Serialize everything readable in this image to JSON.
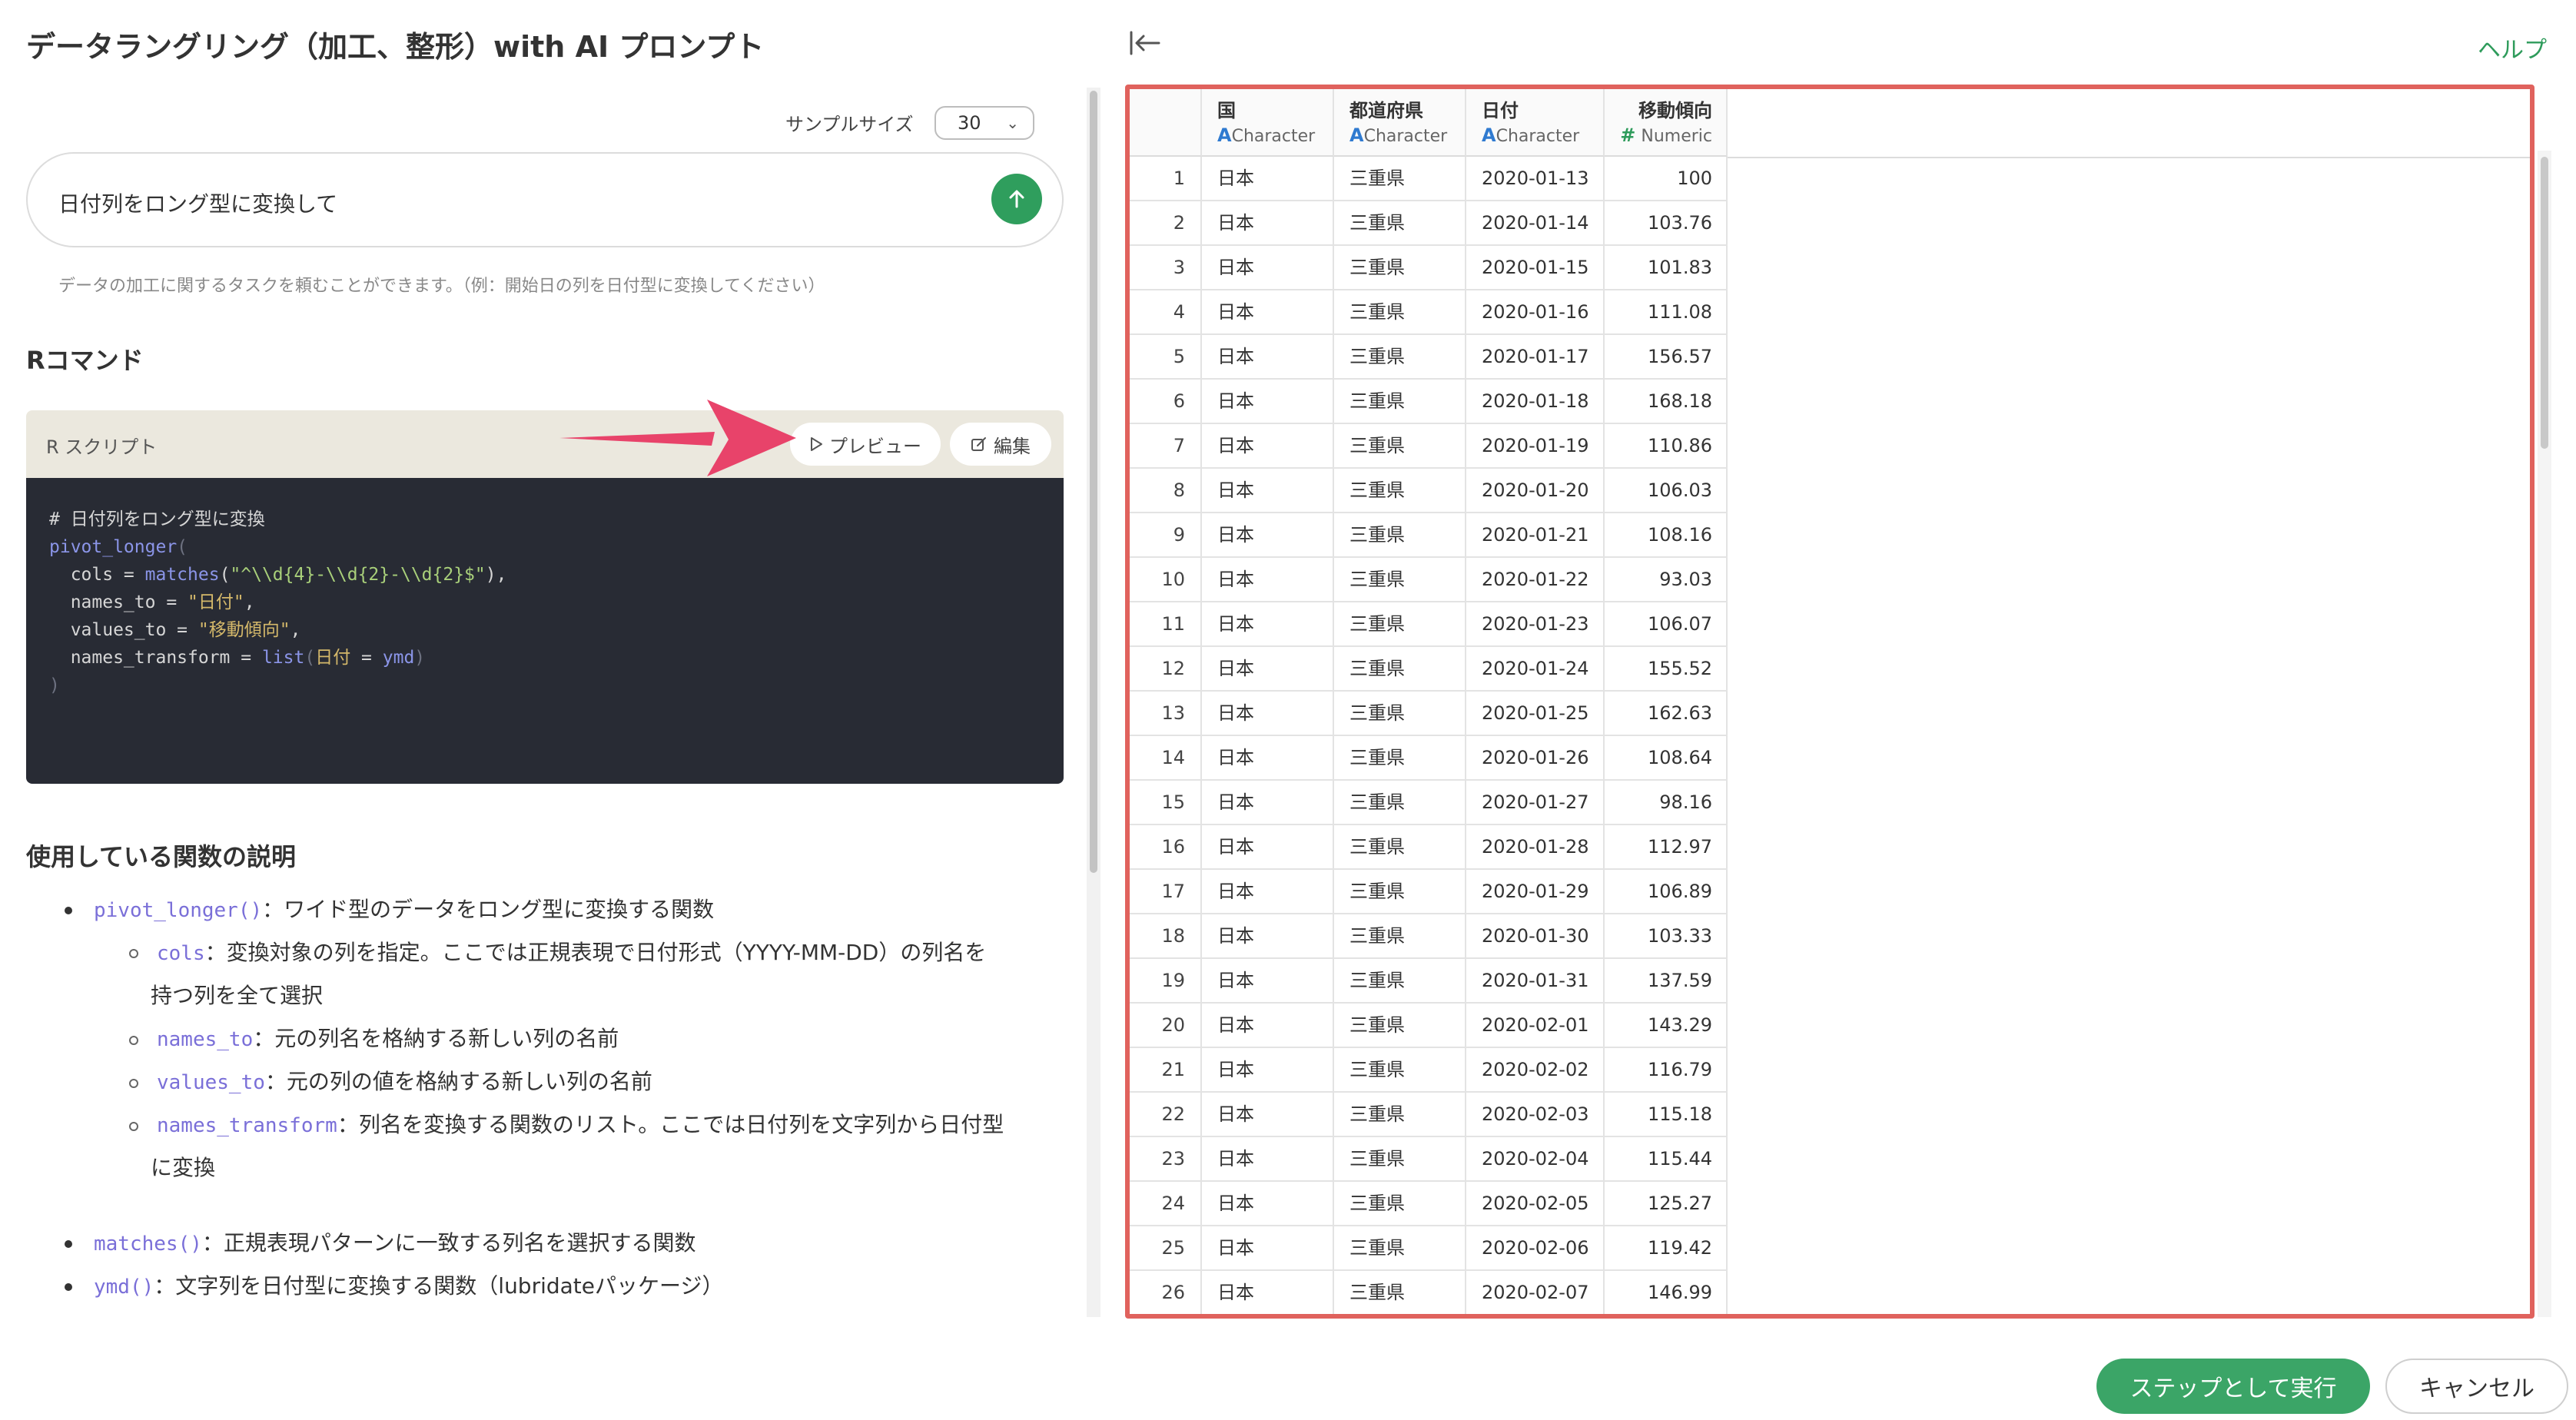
{
  "title": "データラングリング（加工、整形）with AI プロンプト",
  "sample": {
    "label": "サンプルサイズ",
    "value": "30"
  },
  "prompt": {
    "value": "日付列をロング型に変換して",
    "hint": "データの加工に関するタスクを頼むことができます。（例：開始日の列を日付型に変換してください）"
  },
  "r_command_heading": "Rコマンド",
  "script": {
    "label": "R スクリプト",
    "preview_label": "プレビュー",
    "edit_label": "編集",
    "code": {
      "comment": "# 日付列をロング型に変換",
      "fn": "pivot_longer",
      "open": "(",
      "cols_prefix": "  cols = ",
      "matches_fn": "matches",
      "matches_arg": "\"^\\\\d{4}-\\\\d{2}-\\\\d{2}$\"",
      "cols_suffix": "),",
      "names_to_prefix": "  names_to = ",
      "names_to_val": "\"日付\"",
      "names_to_suffix": ",",
      "values_to_prefix": "  values_to = ",
      "values_to_val": "\"移動傾向\"",
      "values_to_suffix": ",",
      "transform_prefix": "  names_transform = ",
      "list_fn": "list",
      "list_open": "(",
      "list_key": "日付",
      "list_eq": " = ",
      "list_val": "ymd",
      "list_close": ")",
      "close": ")"
    }
  },
  "functions": {
    "heading": "使用している関数の説明",
    "pivot_code": "pivot_longer()",
    "pivot_desc": "：ワイド型のデータをロング型に変換する関数",
    "cols_code": "cols",
    "cols_desc_1": "：変換対象の列を指定。ここでは正規表現で日付形式（YYYY-MM-DD）の列名を",
    "cols_desc_2": "持つ列を全て選択",
    "names_to_code": "names_to",
    "names_to_desc": "：元の列名を格納する新しい列の名前",
    "values_to_code": "values_to",
    "values_to_desc": "：元の列の値を格納する新しい列の名前",
    "transform_code": "names_transform",
    "transform_desc_1": "：列名を変換する関数のリスト。ここでは日付列を文字列から日付型",
    "transform_desc_2": "に変換",
    "matches_code": "matches()",
    "matches_desc": "：正規表現パターンに一致する列名を選択する関数",
    "ymd_code": "ymd()",
    "ymd_desc": "：文字列を日付型に変換する関数（lubridateパッケージ）"
  },
  "help_label": "ヘルプ",
  "table": {
    "columns": [
      {
        "name": "国",
        "type_icon": "A",
        "type": "Character"
      },
      {
        "name": "都道府県",
        "type_icon": "A",
        "type": "Character"
      },
      {
        "name": "日付",
        "type_icon": "A",
        "type": "Character"
      },
      {
        "name": "移動傾向",
        "type_icon": "#",
        "type": "Numeric"
      }
    ],
    "rows": [
      [
        "1",
        "日本",
        "三重県",
        "2020-01-13",
        "100"
      ],
      [
        "2",
        "日本",
        "三重県",
        "2020-01-14",
        "103.76"
      ],
      [
        "3",
        "日本",
        "三重県",
        "2020-01-15",
        "101.83"
      ],
      [
        "4",
        "日本",
        "三重県",
        "2020-01-16",
        "111.08"
      ],
      [
        "5",
        "日本",
        "三重県",
        "2020-01-17",
        "156.57"
      ],
      [
        "6",
        "日本",
        "三重県",
        "2020-01-18",
        "168.18"
      ],
      [
        "7",
        "日本",
        "三重県",
        "2020-01-19",
        "110.86"
      ],
      [
        "8",
        "日本",
        "三重県",
        "2020-01-20",
        "106.03"
      ],
      [
        "9",
        "日本",
        "三重県",
        "2020-01-21",
        "108.16"
      ],
      [
        "10",
        "日本",
        "三重県",
        "2020-01-22",
        "93.03"
      ],
      [
        "11",
        "日本",
        "三重県",
        "2020-01-23",
        "106.07"
      ],
      [
        "12",
        "日本",
        "三重県",
        "2020-01-24",
        "155.52"
      ],
      [
        "13",
        "日本",
        "三重県",
        "2020-01-25",
        "162.63"
      ],
      [
        "14",
        "日本",
        "三重県",
        "2020-01-26",
        "108.64"
      ],
      [
        "15",
        "日本",
        "三重県",
        "2020-01-27",
        "98.16"
      ],
      [
        "16",
        "日本",
        "三重県",
        "2020-01-28",
        "112.97"
      ],
      [
        "17",
        "日本",
        "三重県",
        "2020-01-29",
        "106.89"
      ],
      [
        "18",
        "日本",
        "三重県",
        "2020-01-30",
        "103.33"
      ],
      [
        "19",
        "日本",
        "三重県",
        "2020-01-31",
        "137.59"
      ],
      [
        "20",
        "日本",
        "三重県",
        "2020-02-01",
        "143.29"
      ],
      [
        "21",
        "日本",
        "三重県",
        "2020-02-02",
        "116.79"
      ],
      [
        "22",
        "日本",
        "三重県",
        "2020-02-03",
        "115.18"
      ],
      [
        "23",
        "日本",
        "三重県",
        "2020-02-04",
        "115.44"
      ],
      [
        "24",
        "日本",
        "三重県",
        "2020-02-05",
        "125.27"
      ],
      [
        "25",
        "日本",
        "三重県",
        "2020-02-06",
        "119.42"
      ],
      [
        "26",
        "日本",
        "三重県",
        "2020-02-07",
        "146.99"
      ]
    ]
  },
  "footer": {
    "run_label": "ステップとして実行",
    "cancel_label": "キャンセル"
  },
  "colors": {
    "accent_green": "#3ba567",
    "highlight_red": "#e0625d",
    "arrow_pink": "#e8436a"
  },
  "icons": [
    "send-arrow-icon",
    "play-icon",
    "edit-icon",
    "collapse-panel-icon",
    "chevron-down-icon"
  ]
}
